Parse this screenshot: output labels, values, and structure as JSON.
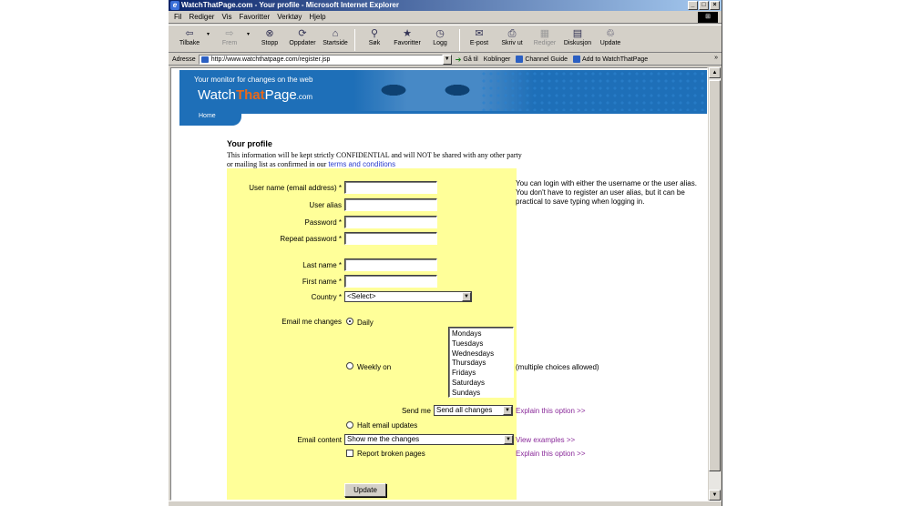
{
  "window": {
    "title": "WatchThatPage.com - Your profile - Microsoft Internet Explorer",
    "controls": [
      "_",
      "□",
      "×"
    ]
  },
  "menu": [
    "Fil",
    "Rediger",
    "Vis",
    "Favoritter",
    "Verktøy",
    "Hjelp"
  ],
  "toolbar": [
    {
      "icon": "back-icon",
      "label": "Tilbake",
      "disabled": false
    },
    {
      "icon": "forward-icon",
      "label": "Frem",
      "disabled": true
    },
    {
      "icon": "stop-icon",
      "label": "Stopp",
      "disabled": false
    },
    {
      "icon": "refresh-icon",
      "label": "Oppdater",
      "disabled": false
    },
    {
      "icon": "home-icon",
      "label": "Startside",
      "disabled": false
    },
    {
      "icon": "search-icon",
      "label": "Søk",
      "disabled": false
    },
    {
      "icon": "favorites-icon",
      "label": "Favoritter",
      "disabled": false
    },
    {
      "icon": "history-icon",
      "label": "Logg",
      "disabled": false
    },
    {
      "icon": "mail-icon",
      "label": "E-post",
      "disabled": false
    },
    {
      "icon": "print-icon",
      "label": "Skriv ut",
      "disabled": false
    },
    {
      "icon": "edit-icon",
      "label": "Rediger",
      "disabled": true
    },
    {
      "icon": "discuss-icon",
      "label": "Diskusjon",
      "disabled": false
    },
    {
      "icon": "update-icon",
      "label": "Update",
      "disabled": false
    }
  ],
  "address": {
    "label": "Adresse",
    "url": "http://www.watchthatpage.com/register.jsp",
    "go": "Gå til",
    "links_label": "Koblinger",
    "links": [
      "Channel Guide",
      "Add to WatchThatPage"
    ]
  },
  "site": {
    "tagline": "Your monitor for changes on the web",
    "logo_pre": "Watch",
    "logo_accent": "That",
    "logo_post": "Page",
    "logo_tld": ".com",
    "nav_home": "Home"
  },
  "intro": {
    "title": "Your profile",
    "text": "This information will be kept strictly CONFIDENTIAL and will NOT be shared with any other party or mailing list as confirmed in our ",
    "link": "terms and conditions"
  },
  "form": {
    "username_label": "User name (email address) *",
    "alias_label": "User alias",
    "password_label": "Password *",
    "repeat_label": "Repeat password *",
    "lastname_label": "Last name *",
    "firstname_label": "First name *",
    "country_label": "Country *",
    "country_value": "<Select>",
    "email_changes_label": "Email me changes",
    "daily_label": "Daily",
    "weekly_label": "Weekly on",
    "days": [
      "Mondays",
      "Tuesdays",
      "Wednesdays",
      "Thursdays",
      "Fridays",
      "Saturdays",
      "Sundays"
    ],
    "multiple_note": "(multiple choices allowed)",
    "send_me_label": "Send me",
    "send_me_value": "Send all changes",
    "explain_option": "Explain this option >>",
    "halt_label": "Halt email updates",
    "content_label": "Email content",
    "content_value": "Show me the changes",
    "view_examples": "View examples >>",
    "explain_option2": "Explain this option >>",
    "broken_label": "Report broken pages",
    "update_button": "Update"
  },
  "help": "You can login with either the username or the user alias. You don't have to register an user alias, but it can be practical to save typing when logging in."
}
